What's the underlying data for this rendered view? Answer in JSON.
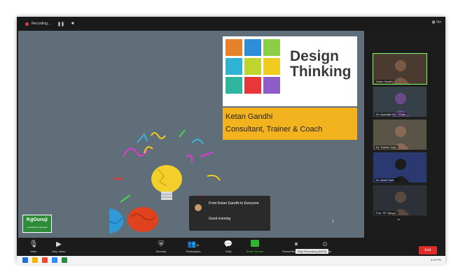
{
  "window": {
    "recording_label": "Recording...",
    "pause_icon": "pause-icon",
    "stop_icon": "stop-icon",
    "view_label": "Vie"
  },
  "slide": {
    "title_line1": "Design",
    "title_line2": "Thinking",
    "caption_line1": "Ketan Gandhi",
    "caption_line2": "Consultant, Trainer & Coach",
    "sticky_colors": [
      "#e5822b",
      "#2e8fd8",
      "#8ccf46",
      "#2eb3d2",
      "#bfd52e",
      "#f0cc20",
      "#2fb49d",
      "#e8363a",
      "#8e5dc7"
    ],
    "page_number": "1"
  },
  "logo": {
    "name": "KgGuruji",
    "tagline": "Consulting & Seminar"
  },
  "chat_popup": {
    "from": "From Ketan Gandhi to Everyone",
    "message": "Good evening"
  },
  "gallery": [
    {
      "name": "Ketan Gandhi",
      "active": true,
      "bg": "#4a3a30",
      "person": "#7a5a45"
    },
    {
      "name": "Dr. Aparajita Sh... Finan",
      "active": false,
      "bg": "#364049",
      "person": "#6b4a8a"
    },
    {
      "name": "Dr. Tushar Cha...",
      "active": false,
      "bg": "#5a5446",
      "person": "#8a6a55"
    },
    {
      "name": "Dr. Mahil Gadi...",
      "active": false,
      "bg": "#2a3a70",
      "person": "#1c1c1c"
    },
    {
      "name": "Prof. SP Vijaya...",
      "active": false,
      "bg": "#2d3036",
      "person": "#5a4a40"
    }
  ],
  "toolbar": {
    "mute": "Mute",
    "stop_video": "Stop Video",
    "security": "Security",
    "participants": "Participants",
    "participants_count": "64",
    "chat": "Chat",
    "share_screen": "Share Screen",
    "pause_stop_recording": "Pause/Stop Recording",
    "reactions": "Reactions",
    "stop_tooltip": "Stop Recording (Alt+R)",
    "end": "End"
  },
  "taskbar": {
    "clock": "6:30 PM"
  }
}
